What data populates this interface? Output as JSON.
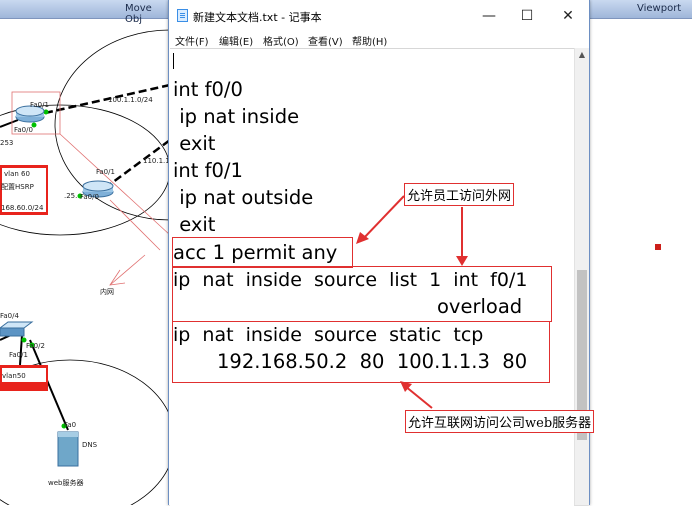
{
  "packet_tracer": {
    "toolbar_move": "Move Obj",
    "toolbar_viewport": "Viewport",
    "labels": {
      "router1_fa01": "Fa0/1",
      "router1_fa00": "Fa0/0",
      "link_100": "100.1.1.0/24",
      "ip_253": "253",
      "vlan60": "vlan 60",
      "hsrp": "配置HSRP",
      "net_168": "168.60.0/24",
      "router2_fa01": "Fa0/1",
      "router2_fa00": "Fa0/0",
      "ip_25": ".25.",
      "link_110": "110.1.1",
      "inner_net": "内网",
      "sw_fa04": "Fa0/4",
      "sw_fa02": "Fa0/2",
      "sw_fa01": "Fa0/1",
      "vlan50": "vlan50",
      "server_fa0": "Fa0",
      "dns": "DNS",
      "web_server": "web服务器"
    }
  },
  "notepad": {
    "title": "新建文本文档.txt - 记事本",
    "controls": {
      "minimize": "—",
      "maximize": "☐",
      "close": "✕"
    },
    "menu": [
      "文件(F)",
      "编辑(E)",
      "格式(O)",
      "查看(V)",
      "帮助(H)"
    ],
    "lines": [
      "int f0/0",
      " ip nat inside",
      " exit",
      "int f0/1",
      " ip nat outside",
      " exit",
      "acc 1 permit any",
      "ip  nat  inside  source  list  1  int  f0/1",
      "overload",
      "ip  nat  inside  source  static  tcp",
      "192.168.50.2  80  100.1.1.3  80"
    ]
  },
  "annotations": {
    "note_employee": "允许员工访问外网",
    "note_internet": "允许互联网访问公司web服务器"
  },
  "colors": {
    "accent_red": "#e03030",
    "link_green": "#00c000",
    "vlan_red": "#e8231c"
  }
}
